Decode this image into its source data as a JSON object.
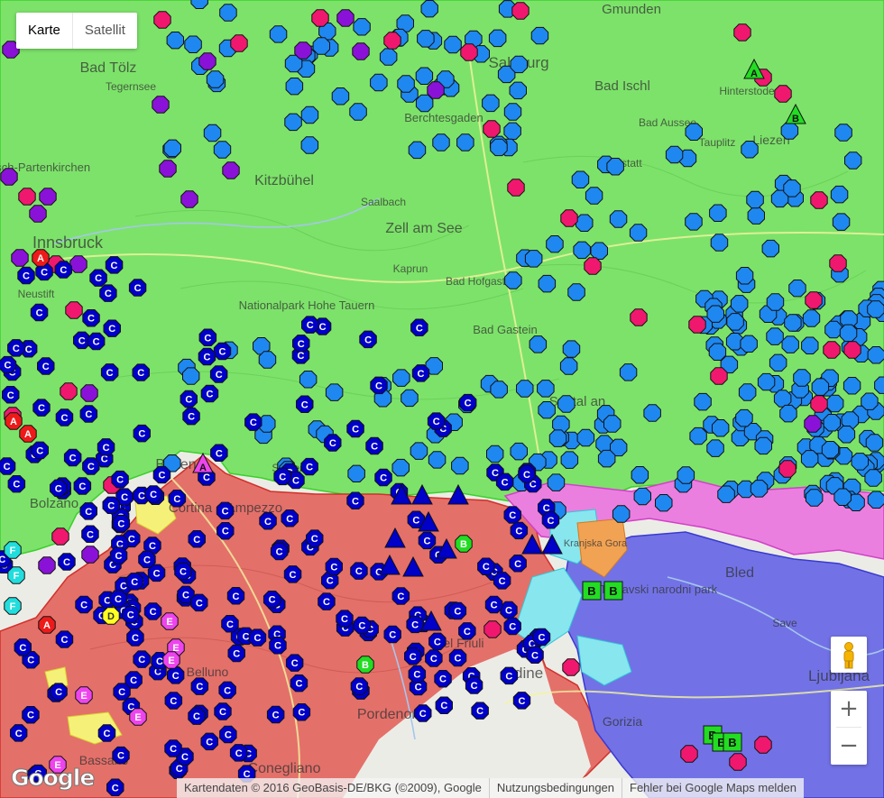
{
  "map_type_control": {
    "active": "Karte",
    "inactive": "Satellit"
  },
  "zoom": {
    "in": "+",
    "out": "−"
  },
  "google_logo": "Google",
  "attribution": {
    "data": "Kartendaten © 2016 GeoBasis-DE/BKG (©2009), Google",
    "terms": "Nutzungsbedingungen",
    "report": "Fehler bei Google Maps melden"
  },
  "colors": {
    "region_green": "#7de26a",
    "region_red": "#e4706a",
    "region_magenta": "#ea7fe0",
    "region_blue": "#7272e6",
    "region_cyan": "#88e6ee",
    "region_orange": "#f2a253",
    "region_yellow": "#f5f178",
    "marker_c": "#0000c8",
    "marker_light_blue": "#1e88f0",
    "marker_pink": "#f0186e",
    "marker_purple": "#8a12d8",
    "marker_red": "#ee1a1a",
    "marker_magenta": "#ee44ee",
    "marker_green": "#22dd22",
    "marker_yellow": "#ffff22",
    "marker_cyan": "#22dddd"
  },
  "place_labels": [
    "Gmunden",
    "Bad Tölz",
    "Tegernsee",
    "Salzburg",
    "Bad Ischl",
    "Hinterstoder",
    "Bad Aussee",
    "Tauplitz",
    "Liezen",
    "Hallstatt",
    "Berchtesgaden",
    "Kitzbühel",
    "Saalbach",
    "Zell am See",
    "Innsbruck",
    "Kaprun",
    "Bad Hofgastein",
    "Nationalpark Hohe Tauern",
    "Bad Gastein",
    "Spittal an",
    "Brixen",
    "Sexten",
    "Cortina d'Ampezzo",
    "Bolzano",
    "Triglavski narodni park",
    "Bled",
    "Ljubljana",
    "Udine",
    "Pordenone",
    "Conegliano",
    "Gorizia",
    "Belluno",
    "Bassano",
    "del Friuli",
    "Kranjska Gora",
    "Neustift",
    "Garmisch-Partenkirchen",
    "Save"
  ],
  "markers": {
    "c_letter": "C",
    "letters": [
      {
        "letter": "A",
        "color": "red"
      },
      {
        "letter": "B",
        "color": "green"
      },
      {
        "letter": "D",
        "color": "yellow"
      },
      {
        "letter": "E",
        "color": "magenta"
      },
      {
        "letter": "F",
        "color": "cyan"
      }
    ]
  }
}
